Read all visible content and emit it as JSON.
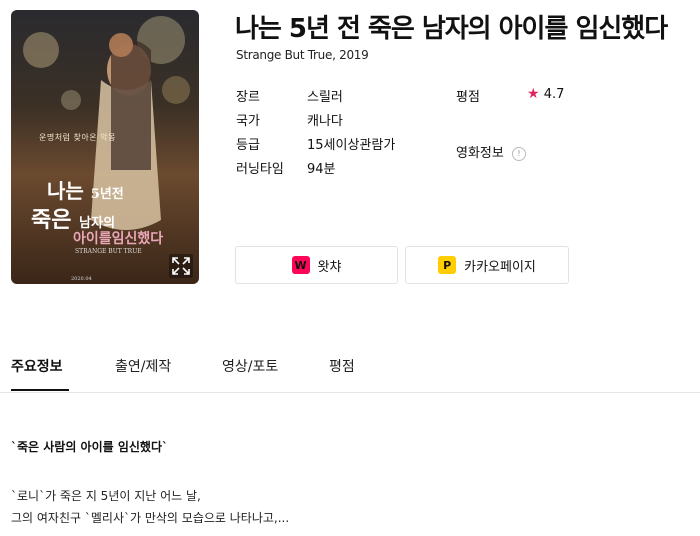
{
  "movie": {
    "title": "나는 5년 전 죽은 남자의 아이를 임신했다",
    "subtitle": "Strange But True, 2019"
  },
  "poster": {
    "tagline": "운명처럼 찾아온 악몽",
    "line1": "나는",
    "line1b": "5년전",
    "line2": "죽은",
    "line2b": "남자의",
    "line3": "아이를임신했다",
    "line4": "STRANGE BUT TRUE",
    "date": "2020.04"
  },
  "info": {
    "genre_label": "장르",
    "genre": "스릴러",
    "country_label": "국가",
    "country": "캐나다",
    "rating_label": "등급",
    "rating": "15세이상관람가",
    "runtime_label": "러닝타임",
    "runtime": "94분",
    "score_label": "평점",
    "score_star": "★",
    "score": "4.7",
    "movieinfo_label": "영화정보",
    "movieinfo_icon": "!"
  },
  "buttons": {
    "watcha": "왓챠",
    "watcha_logo": "W",
    "kakao": "카카오페이지",
    "kakao_logo": "P"
  },
  "tabs": [
    "주요정보",
    "출연/제작",
    "영상/포토",
    "평점"
  ],
  "synopsis": {
    "headline": "`죽은 사람의 아이를 임신했다`",
    "line1": "`로니`가 죽은 지 5년이 지난 어느 날,",
    "line2": "그의 여자친구 `멜리사`가 만삭의 모습으로 나타나고,..."
  },
  "colors": {
    "accent_star": "#e0245e",
    "watcha": "#ff0558",
    "kakao": "#ffcd00"
  }
}
